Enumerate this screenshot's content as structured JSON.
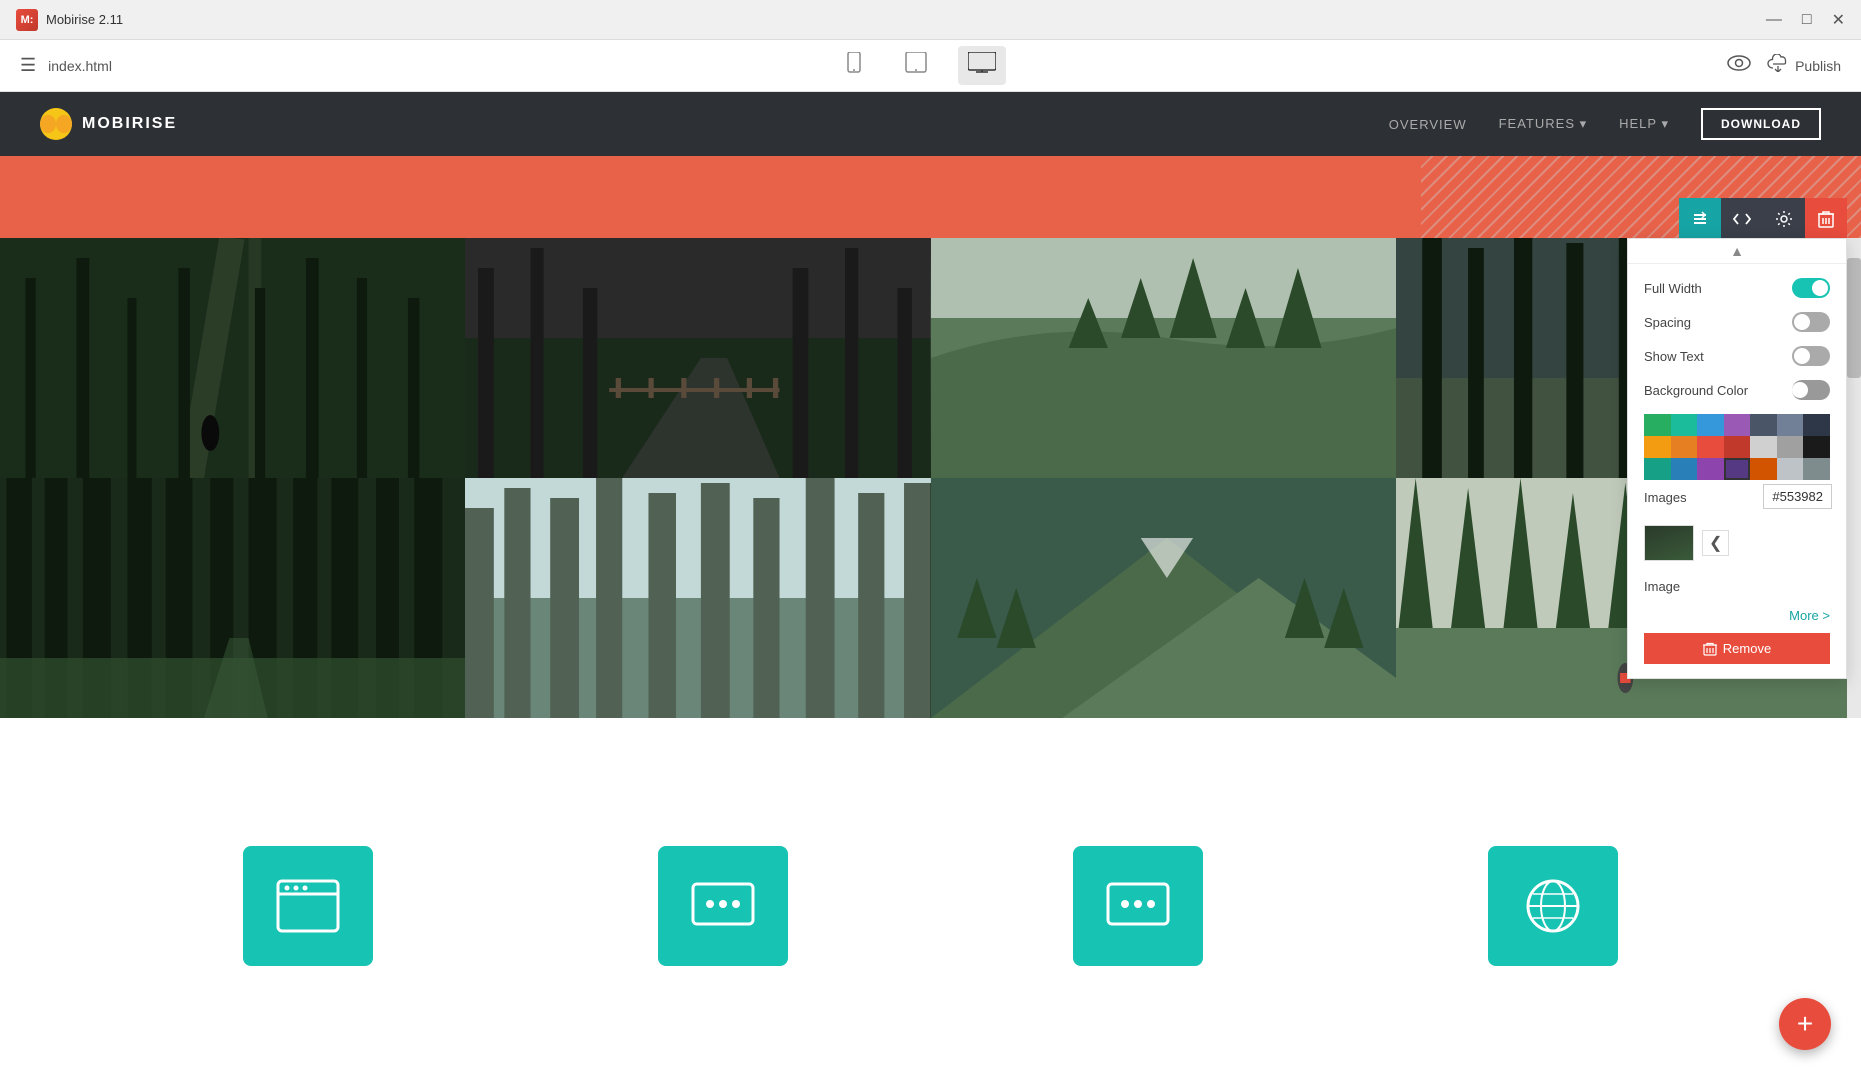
{
  "titlebar": {
    "logo": "M",
    "title": "Mobirise 2.11",
    "controls": [
      "—",
      "□",
      "✕"
    ]
  },
  "toolbar": {
    "hamburger": "☰",
    "filename": "index.html",
    "devices": [
      {
        "name": "mobile",
        "icon": "📱",
        "active": false
      },
      {
        "name": "tablet",
        "icon": "📟",
        "active": false
      },
      {
        "name": "desktop",
        "icon": "🖥",
        "active": true
      }
    ],
    "preview_icon": "👁",
    "publish_label": "Publish",
    "cloud_icon": "☁"
  },
  "navbar": {
    "brand": "MOBIRISE",
    "links": [
      "OVERVIEW",
      "FEATURES ▾",
      "HELP ▾"
    ],
    "download_label": "DOWNLOAD"
  },
  "panel": {
    "toolbar_buttons": [
      {
        "name": "arrows",
        "icon": "⇅",
        "style": "teal"
      },
      {
        "name": "code",
        "icon": "</>",
        "style": "dark"
      },
      {
        "name": "settings",
        "icon": "⚙",
        "style": "dark"
      },
      {
        "name": "delete",
        "icon": "🗑",
        "style": "red"
      }
    ],
    "settings": [
      {
        "label": "Full Width",
        "toggle": "on"
      },
      {
        "label": "Spacing",
        "toggle": "off"
      },
      {
        "label": "Show Text",
        "toggle": "off"
      },
      {
        "label": "Background Color",
        "toggle": "grey"
      }
    ],
    "images_label": "Images",
    "image_nav": "❮",
    "image_label": "Image",
    "more_label": "More >",
    "remove_label": "Remove",
    "color_tooltip": "#553982",
    "palette": [
      "#27ae60",
      "#1abc9c",
      "#3498db",
      "#9b59b6",
      "#2c3e50",
      "#f39c12",
      "#e74c3c",
      "#ecf0f1",
      "#95a5a6",
      "#16a085",
      "#2980b9",
      "#8e44ad",
      "#2c3e50",
      "#d35400",
      "#c0392b",
      "#bdc3c7",
      "#7f8c8d",
      "#1abc9c",
      "#3498db",
      "#9b59b6",
      "#f1c40f",
      "#e67e22",
      "#e74c3c",
      "#ecf0f1",
      "#2c3e50",
      "#27ae60",
      "#16a085",
      "#2980b9",
      "#8e44ad",
      "#95a5a6",
      "#f39c12",
      "#d35400",
      "#c0392b",
      "#bdc3c7",
      "#7f8c8d"
    ]
  },
  "fab": {
    "icon": "+"
  },
  "bottom_icons": [
    {
      "type": "document"
    },
    {
      "type": "chat"
    },
    {
      "type": "chat2"
    },
    {
      "type": "globe"
    }
  ]
}
